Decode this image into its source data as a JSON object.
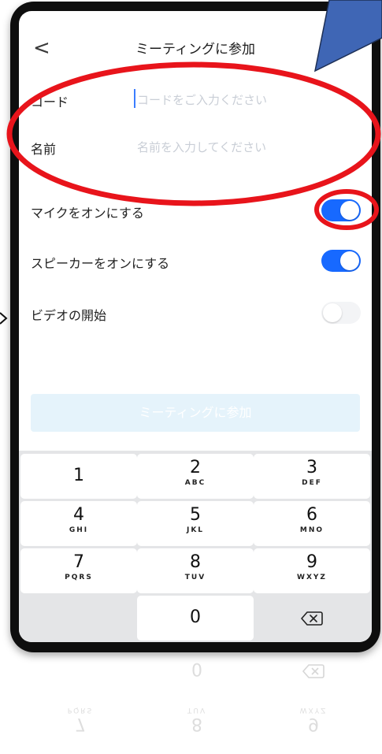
{
  "header": {
    "back_icon": "chevron-left-icon",
    "back_glyph": "<",
    "title": "ミーティングに参加"
  },
  "form": {
    "code": {
      "label": "コード",
      "placeholder": "コードをご入力ください",
      "value": ""
    },
    "name": {
      "label": "名前",
      "placeholder": "名前を入力してください",
      "value": ""
    }
  },
  "toggles": [
    {
      "label": "マイクをオンにする",
      "on": true
    },
    {
      "label": "スピーカーをオンにする",
      "on": true
    },
    {
      "label": "ビデオの開始",
      "on": false
    }
  ],
  "join_button": {
    "label": "ミーティングに参加"
  },
  "keypad": {
    "keys": [
      {
        "num": "1",
        "letters": ""
      },
      {
        "num": "2",
        "letters": "ABC"
      },
      {
        "num": "3",
        "letters": "DEF"
      },
      {
        "num": "4",
        "letters": "GHI"
      },
      {
        "num": "5",
        "letters": "JKL"
      },
      {
        "num": "6",
        "letters": "MNO"
      },
      {
        "num": "7",
        "letters": "PQRS"
      },
      {
        "num": "8",
        "letters": "TUV"
      },
      {
        "num": "9",
        "letters": "WXYZ"
      },
      {
        "num": "",
        "letters": ""
      },
      {
        "num": "0",
        "letters": ""
      },
      {
        "num": "",
        "letters": "",
        "icon": "backspace-icon"
      }
    ]
  },
  "colors": {
    "accent": "#1769ff",
    "annotation": "#e8141b",
    "callout": "#3f66b5"
  }
}
